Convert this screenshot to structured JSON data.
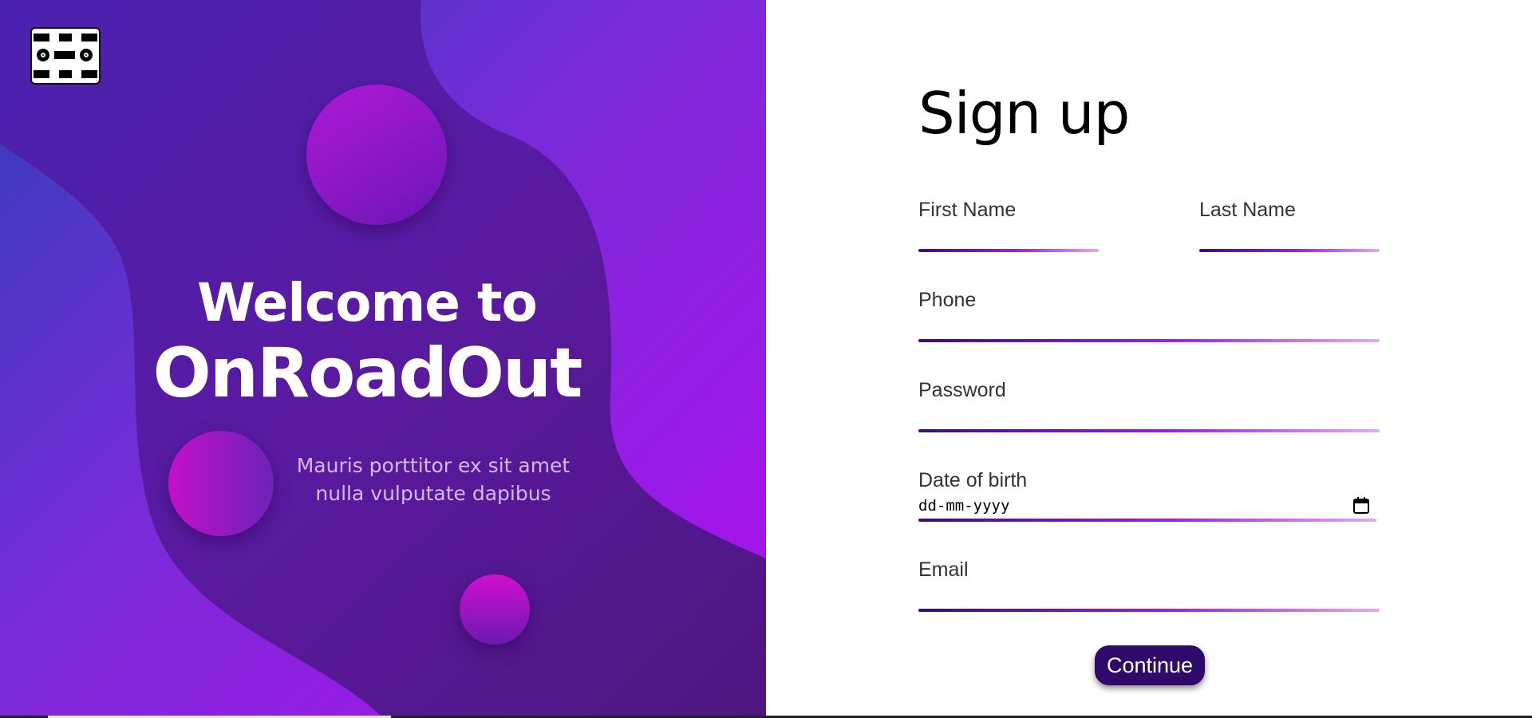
{
  "hero": {
    "logo_icon": "road-logo-icon",
    "welcome_line1": "Welcome to",
    "welcome_line2": "OnRoadOut",
    "tagline": "Mauris porttitor ex sit amet nulla vulputate dapibus",
    "colors": {
      "start": "#2f3fb8",
      "mid": "#7a2bd8",
      "end": "#b00ff0",
      "wave": "#5a1aa0"
    }
  },
  "form": {
    "title": "Sign up",
    "first_name_label": "First Name",
    "last_name_label": "Last Name",
    "phone_label": "Phone",
    "password_label": "Password",
    "dob_label": "Date of birth",
    "dob_placeholder": "dd-mm-yyyy",
    "email_label": "Email",
    "continue_label": "Continue",
    "calendar_icon": "calendar-icon",
    "colors": {
      "line_start": "#3a0d7a",
      "line_mid": "#a11ee0",
      "line_end": "#e8a8f4",
      "button": "#2f0a6b"
    }
  }
}
